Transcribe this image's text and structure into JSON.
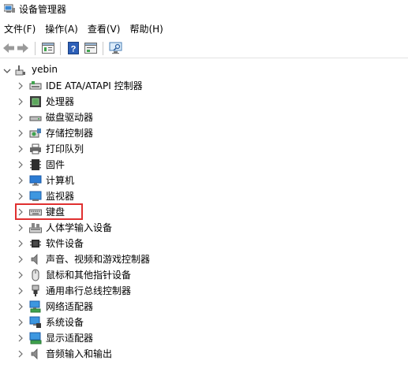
{
  "window": {
    "title": "设备管理器"
  },
  "menu": [
    "文件(F)",
    "操作(A)",
    "查看(V)",
    "帮助(H)"
  ],
  "toolbar": {
    "buttons": [
      "back-icon",
      "forward-icon",
      "properties-icon",
      "help-icon",
      "show-hidden-icon",
      "monitor-scan-icon"
    ]
  },
  "tree": {
    "root": "yebin",
    "items": [
      {
        "label": "IDE ATA/ATAPI 控制器",
        "icon": "ide-controller-icon"
      },
      {
        "label": "处理器",
        "icon": "processor-icon"
      },
      {
        "label": "磁盘驱动器",
        "icon": "disk-drive-icon"
      },
      {
        "label": "存储控制器",
        "icon": "storage-controller-icon"
      },
      {
        "label": "打印队列",
        "icon": "printer-icon"
      },
      {
        "label": "固件",
        "icon": "firmware-icon"
      },
      {
        "label": "计算机",
        "icon": "computer-icon"
      },
      {
        "label": "监视器",
        "icon": "monitor-icon"
      },
      {
        "label": "键盘",
        "icon": "keyboard-icon",
        "highlighted": true
      },
      {
        "label": "人体学输入设备",
        "icon": "hid-icon"
      },
      {
        "label": "软件设备",
        "icon": "software-device-icon"
      },
      {
        "label": "声音、视频和游戏控制器",
        "icon": "speaker-icon"
      },
      {
        "label": "鼠标和其他指针设备",
        "icon": "mouse-icon"
      },
      {
        "label": "通用串行总线控制器",
        "icon": "usb-icon"
      },
      {
        "label": "网络适配器",
        "icon": "network-adapter-icon"
      },
      {
        "label": "系统设备",
        "icon": "system-device-icon"
      },
      {
        "label": "显示适配器",
        "icon": "display-adapter-icon"
      },
      {
        "label": "音频输入和输出",
        "icon": "audio-io-icon"
      }
    ]
  },
  "colors": {
    "highlight_border": "#e03030",
    "icon_blue": "#2b7bd3",
    "chevron": "#6b6b6b"
  }
}
